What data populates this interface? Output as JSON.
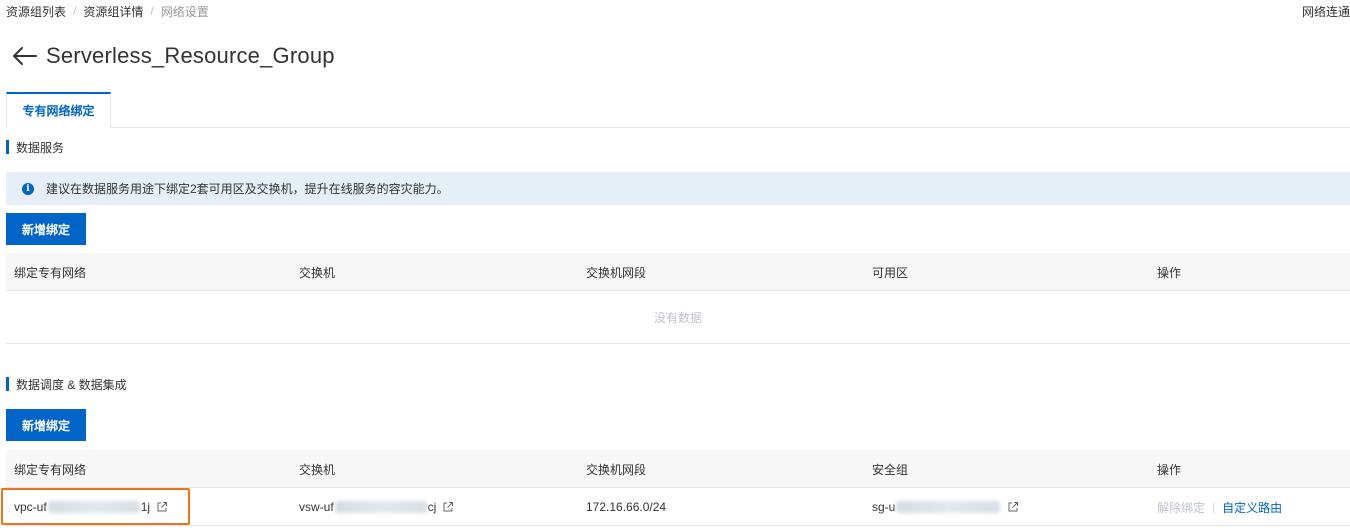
{
  "breadcrumb": {
    "items": [
      "资源组列表",
      "资源组详情",
      "网络设置"
    ],
    "separator": "/"
  },
  "top_right_link": "网络连通",
  "page_title": "Serverless_Resource_Group",
  "tabs": [
    {
      "label": "专有网络绑定",
      "active": true
    }
  ],
  "data_service": {
    "section_title": "数据服务",
    "notice": "建议在数据服务用途下绑定2套可用区及交换机，提升在线服务的容灾能力。",
    "add_button": "新增绑定",
    "columns": [
      "绑定专有网络",
      "交换机",
      "交换机网段",
      "可用区",
      "操作"
    ],
    "empty_text": "没有数据"
  },
  "scheduling": {
    "section_title": "数据调度 & 数据集成",
    "add_button": "新增绑定",
    "columns": [
      "绑定专有网络",
      "交换机",
      "交换机网段",
      "安全组",
      "操作"
    ],
    "rows": [
      {
        "vpc_prefix": "vpc-uf",
        "vpc_suffix": "1j",
        "vswitch_prefix": "vsw-uf",
        "vswitch_suffix": "cj",
        "cidr": "172.16.66.0/24",
        "sg_prefix": "sg-u",
        "sg_suffix": "",
        "actions": {
          "unbind": "解除绑定",
          "custom_route": "自定义路由"
        }
      }
    ]
  },
  "colors": {
    "primary": "#0064c8",
    "notice_bg": "#e6eef8",
    "highlight": "#f07416",
    "disabled": "#c0c4cc"
  },
  "icons": {
    "back": "arrow-left-icon",
    "info": "info-icon",
    "external_link": "external-link-icon"
  }
}
